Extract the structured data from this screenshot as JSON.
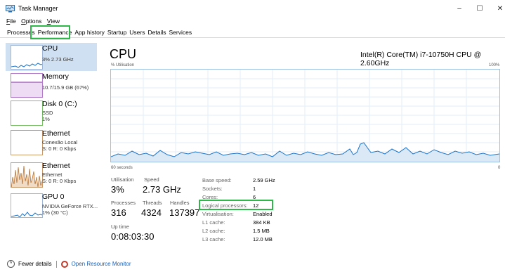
{
  "window": {
    "title": "Task Manager",
    "controls": {
      "minimize": "–",
      "maximize": "☐",
      "close": "✕"
    }
  },
  "menu": [
    {
      "label": "File",
      "mnemonic": "F",
      "rest": "ile"
    },
    {
      "label": "Options",
      "mnemonic": "O",
      "rest": "ptions"
    },
    {
      "label": "View",
      "mnemonic": "V",
      "rest": "iew"
    }
  ],
  "tabs": [
    "Processes",
    "Performance",
    "App history",
    "Startup",
    "Users",
    "Details",
    "Services"
  ],
  "active_tab": "Performance",
  "sidebar": [
    {
      "title": "CPU",
      "sub1": "3% 2.73 GHz",
      "sub2": "",
      "selected": true
    },
    {
      "title": "Memory",
      "sub1": "10.7/15.9 GB (67%)",
      "sub2": "",
      "selected": false
    },
    {
      "title": "Disk 0 (C:)",
      "sub1": "SSD",
      "sub2": "1%",
      "selected": false
    },
    {
      "title": "Ethernet",
      "sub1": "Conexão Local",
      "sub2": "S: 0 R: 0 Kbps",
      "selected": false
    },
    {
      "title": "Ethernet",
      "sub1": "Ethernet",
      "sub2": "S: 0 R: 0 Kbps",
      "selected": false
    },
    {
      "title": "GPU 0",
      "sub1": "NVIDIA GeForce RTX...",
      "sub2": "1% (30 °C)",
      "selected": false
    }
  ],
  "main": {
    "title": "CPU",
    "model": "Intel(R) Core(TM) i7-10750H CPU @ 2.60GHz",
    "util_label": "% Utilisation",
    "util_max": "100%",
    "time_label": "60 seconds",
    "zero_label": "0",
    "stats": {
      "utilisation_label": "Utilisation",
      "utilisation": "3%",
      "speed_label": "Speed",
      "speed": "2.73 GHz",
      "processes_label": "Processes",
      "processes": "316",
      "threads_label": "Threads",
      "threads": "4324",
      "handles_label": "Handles",
      "handles": "137397",
      "uptime_label": "Up time",
      "uptime": "0:08:03:30"
    },
    "specs": [
      {
        "label": "Base speed:",
        "value": "2.59 GHz"
      },
      {
        "label": "Sockets:",
        "value": "1"
      },
      {
        "label": "Cores:",
        "value": "6"
      },
      {
        "label": "Logical processors:",
        "value": "12"
      },
      {
        "label": "Virtualisation:",
        "value": "Enabled"
      },
      {
        "label": "L1 cache:",
        "value": "384 KB"
      },
      {
        "label": "L2 cache:",
        "value": "1.5 MB"
      },
      {
        "label": "L3 cache:",
        "value": "12.0 MB"
      }
    ]
  },
  "footer": {
    "fewer_details": "Fewer details",
    "open_monitor": "Open Resource Monitor"
  },
  "colors": {
    "cpu_graph": "#1a73c8",
    "memory_graph": "#8b2ea8",
    "disk_graph": "#4aa52e",
    "ethernet_graph": "#b5651d",
    "gpu_graph": "#1a73c8",
    "highlight": "#2eb84a"
  }
}
